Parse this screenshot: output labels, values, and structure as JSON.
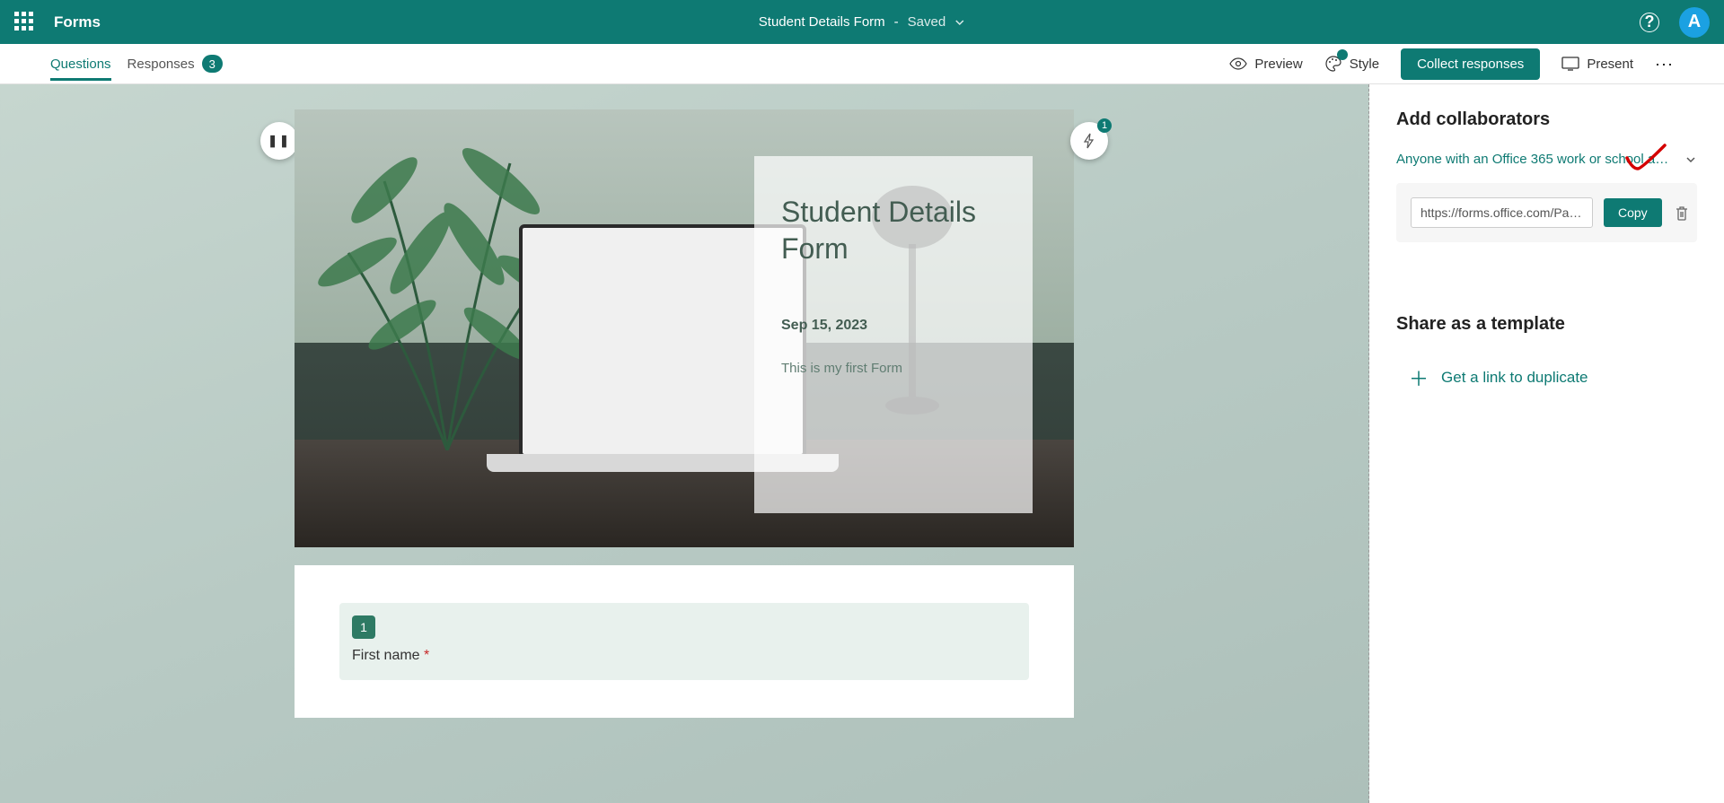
{
  "header": {
    "appName": "Forms",
    "formTitle": "Student Details Form",
    "savedLabel": "Saved",
    "avatarInitial": "A"
  },
  "toolbar": {
    "tabs": {
      "questions": "Questions",
      "responses": "Responses",
      "responsesCount": "3"
    },
    "preview": "Preview",
    "style": "Style",
    "collect": "Collect responses",
    "present": "Present"
  },
  "hero": {
    "title": "Student Details Form",
    "date": "Sep 15, 2023",
    "description": "This is my first Form",
    "suggestionBadge": "1"
  },
  "question1": {
    "number": "1",
    "label": "First name",
    "required": "*"
  },
  "sidePanel": {
    "addCollaborators": "Add collaborators",
    "whoText": "Anyone with an Office 365 work or school acco...",
    "linkValue": "https://forms.office.com/Pag...",
    "copy": "Copy",
    "shareTemplate": "Share as a template",
    "duplicateLink": "Get a link to duplicate"
  }
}
